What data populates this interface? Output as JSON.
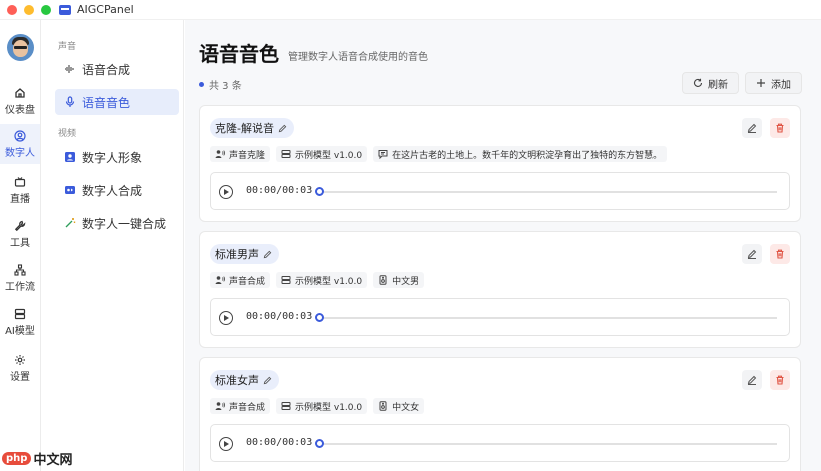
{
  "app": {
    "title": "AIGCPanel"
  },
  "rail": [
    {
      "label": "仪表盘",
      "icon": "home-icon",
      "active": false
    },
    {
      "label": "数字人",
      "icon": "user-circle-icon",
      "active": true
    },
    {
      "label": "直播",
      "icon": "tv-icon",
      "active": false
    },
    {
      "label": "工具",
      "icon": "wrench-icon",
      "active": false
    },
    {
      "label": "工作流",
      "icon": "workflow-icon",
      "active": false
    },
    {
      "label": "AI模型",
      "icon": "server-icon",
      "active": false
    },
    {
      "label": "设置",
      "icon": "gear-icon",
      "active": false
    }
  ],
  "subnav": {
    "groups": [
      {
        "label": "声音",
        "items": [
          {
            "label": "语音合成",
            "icon": "waveform-icon",
            "active": false
          },
          {
            "label": "语音音色",
            "icon": "microphone-icon",
            "active": true
          }
        ]
      },
      {
        "label": "视频",
        "items": [
          {
            "label": "数字人形象",
            "icon": "portrait-icon",
            "active": false
          },
          {
            "label": "数字人合成",
            "icon": "video-icon",
            "active": false
          },
          {
            "label": "数字人一键合成",
            "icon": "magic-wand-icon",
            "active": false
          }
        ]
      }
    ]
  },
  "main": {
    "title": "语音音色",
    "subtitle": "管理数字人语音合成使用的音色",
    "count_text": "共 3 条",
    "refresh_label": "刷新",
    "add_label": "添加"
  },
  "voices": [
    {
      "name": "克隆-解说音",
      "tags": [
        {
          "icon": "user-voice-icon",
          "text": "声音克隆"
        },
        {
          "icon": "model-icon",
          "text": "示例模型 v1.0.0"
        },
        {
          "icon": "message-icon",
          "text": "在这片古老的土地上。数千年的文明积淀孕育出了独特的东方智慧。"
        }
      ],
      "time": "00:00/00:03"
    },
    {
      "name": "标准男声",
      "tags": [
        {
          "icon": "user-voice-icon",
          "text": "声音合成"
        },
        {
          "icon": "model-icon",
          "text": "示例模型 v1.0.0"
        },
        {
          "icon": "speaker-icon",
          "text": "中文男"
        }
      ],
      "time": "00:00/00:03"
    },
    {
      "name": "标准女声",
      "tags": [
        {
          "icon": "user-voice-icon",
          "text": "声音合成"
        },
        {
          "icon": "model-icon",
          "text": "示例模型 v1.0.0"
        },
        {
          "icon": "speaker-icon",
          "text": "中文女"
        }
      ],
      "time": "00:00/00:03"
    }
  ],
  "watermark": {
    "badge": "php",
    "text": "中文网"
  },
  "colors": {
    "accent": "#3b5bdb",
    "danger": "#e05545",
    "active_bg": "#e7edfb"
  }
}
